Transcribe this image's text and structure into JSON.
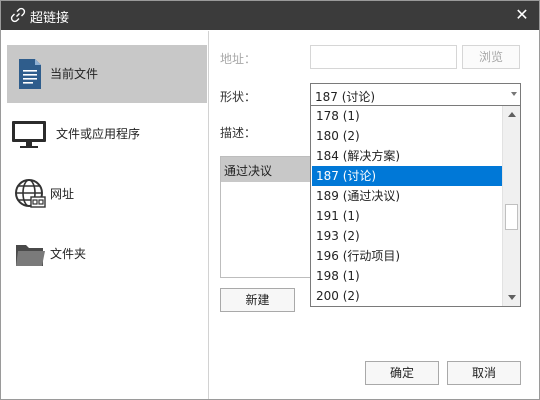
{
  "window": {
    "title": "超链接",
    "close_glyph": "✕",
    "accent": "#0078d7",
    "titlebar_color": "#3b3b3b"
  },
  "sidebar": {
    "items": [
      {
        "label": "当前文件",
        "icon": "document-icon",
        "active": true
      },
      {
        "label": "文件或应用程序",
        "icon": "monitor-icon",
        "active": false
      },
      {
        "label": "网址",
        "icon": "globe-icon",
        "active": false
      },
      {
        "label": "文件夹",
        "icon": "folder-icon",
        "active": false
      }
    ]
  },
  "form": {
    "address_label": "地址：",
    "address_value": "",
    "browse_label": "浏览",
    "shape_label": "形状：",
    "shape_value": "187 (讨论)",
    "description_label": "描述：",
    "description_value": "通过决议"
  },
  "dropdown": {
    "options": [
      "178 (1)",
      "180 (2)",
      "184 (解决方案)",
      "187 (讨论)",
      "189 (通过决议)",
      "191 (1)",
      "193 (2)",
      "196 (行动项目)",
      "198 (1)",
      "200 (2)"
    ],
    "selected_index": 3
  },
  "buttons": {
    "new_label": "新建",
    "ok_label": "确定",
    "cancel_label": "取消"
  }
}
